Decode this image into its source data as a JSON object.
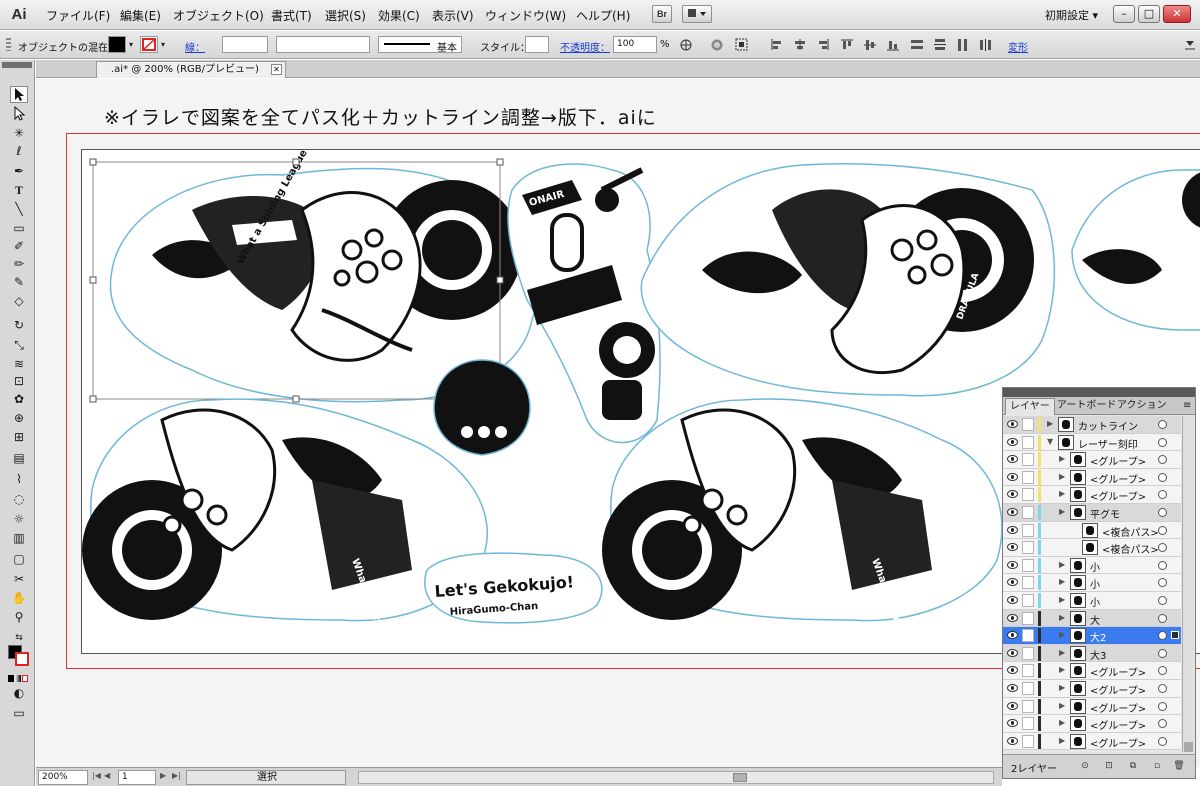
{
  "app": {
    "logo": "Ai"
  },
  "menubar": {
    "items": [
      "ファイル(F)",
      "編集(E)",
      "オブジェクト(O)",
      "書式(T)",
      "選択(S)",
      "効果(C)",
      "表示(V)",
      "ウィンドウ(W)",
      "ヘルプ(H)"
    ],
    "bridge_label": "Br",
    "workspace": "初期設定 ▾",
    "window_buttons": [
      "–",
      "□",
      "✕"
    ]
  },
  "controlbar": {
    "mode_label": "オブジェクトの混在",
    "stroke_label": "線：",
    "brush_label": "基本",
    "style_label": "スタイル：",
    "opacity_label": "不透明度：",
    "opacity_value": "100",
    "opacity_unit": "%",
    "transform_label": "変形"
  },
  "document": {
    "tab_title": ".ai* @ 200% (RGB/プレビュー)",
    "tab_close": "✕",
    "heading_note": "※イラレで図案を全てパス化＋カットライン調整→版下．aiに"
  },
  "artwork": {
    "sticker_text_1": "What a Shining League",
    "sticker_text_2": "Let's Gekokujo!",
    "sticker_text_3": "HiraGumo-Chan",
    "sticker_text_4": "ONAIR",
    "sticker_text_5": "DRAGULA"
  },
  "layers_panel": {
    "tabs": [
      "レイヤー",
      "アートボード",
      "アクション"
    ],
    "rows": [
      {
        "name": "カットライン",
        "indent": 0,
        "open": false,
        "color": "#f0e36a",
        "style": "grey"
      },
      {
        "name": "レーザー刻印",
        "indent": 0,
        "open": true,
        "color": "#f0e36a",
        "style": "normal"
      },
      {
        "name": "<グループ>",
        "indent": 1,
        "open": false,
        "color": "#f0e36a",
        "style": "normal"
      },
      {
        "name": "<グループ>",
        "indent": 1,
        "open": false,
        "color": "#f0e36a",
        "style": "normal"
      },
      {
        "name": "<グループ>",
        "indent": 1,
        "open": false,
        "color": "#f0e36a",
        "style": "normal"
      },
      {
        "name": "平グモ",
        "indent": 1,
        "open": false,
        "color": "#7ad6e8",
        "style": "grey"
      },
      {
        "name": "<複合パス>",
        "indent": 2,
        "open": null,
        "color": "#7ad6e8",
        "style": "normal"
      },
      {
        "name": "<複合パス>",
        "indent": 2,
        "open": null,
        "color": "#7ad6e8",
        "style": "normal"
      },
      {
        "name": "小",
        "indent": 1,
        "open": false,
        "color": "#7ad6e8",
        "style": "normal"
      },
      {
        "name": "小",
        "indent": 1,
        "open": false,
        "color": "#7ad6e8",
        "style": "normal"
      },
      {
        "name": "小",
        "indent": 1,
        "open": false,
        "color": "#7ad6e8",
        "style": "normal"
      },
      {
        "name": "大",
        "indent": 1,
        "open": false,
        "color": "#2b2b2b",
        "style": "grey"
      },
      {
        "name": "大2",
        "indent": 1,
        "open": false,
        "color": "#2b2b2b",
        "style": "highlight"
      },
      {
        "name": "大3",
        "indent": 1,
        "open": false,
        "color": "#2b2b2b",
        "style": "grey"
      },
      {
        "name": "<グループ>",
        "indent": 1,
        "open": false,
        "color": "#2b2b2b",
        "style": "normal"
      },
      {
        "name": "<グループ>",
        "indent": 1,
        "open": false,
        "color": "#2b2b2b",
        "style": "normal"
      },
      {
        "name": "<グループ>",
        "indent": 1,
        "open": false,
        "color": "#2b2b2b",
        "style": "normal"
      },
      {
        "name": "<グループ>",
        "indent": 1,
        "open": false,
        "color": "#2b2b2b",
        "style": "normal"
      },
      {
        "name": "<グループ>",
        "indent": 1,
        "open": false,
        "color": "#2b2b2b",
        "style": "normal"
      }
    ],
    "layer_count": "2レイヤー"
  },
  "statusbar": {
    "zoom": "200%",
    "page": "1",
    "status": "選択"
  },
  "colors": {
    "artboard_border": "#d93535",
    "selection_accent": "#3a7cf0",
    "cutline": "#6fb7d9"
  }
}
